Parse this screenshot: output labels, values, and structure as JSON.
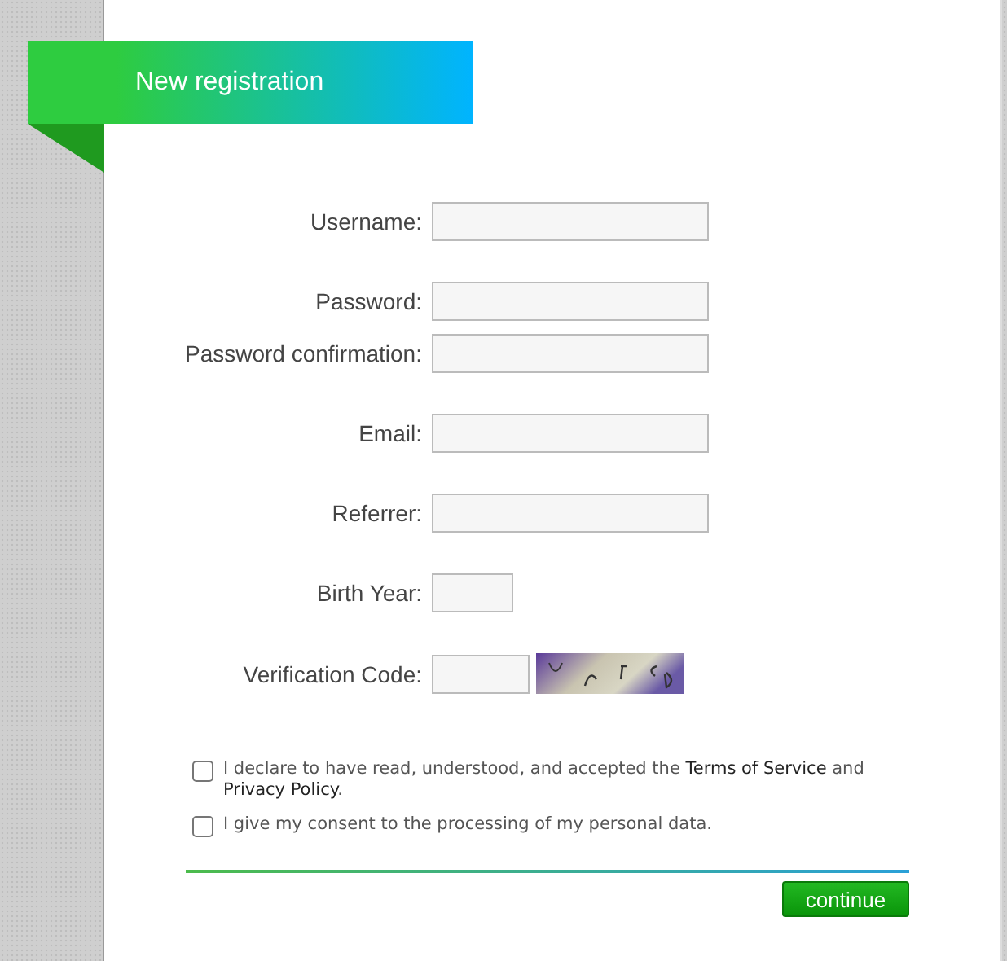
{
  "header": {
    "title": "New registration"
  },
  "field_groups": [
    [
      {
        "label": "Username:",
        "kind": "text"
      }
    ],
    [
      {
        "label": "Password:",
        "kind": "text"
      },
      {
        "label": "Password confirmation:",
        "kind": "text"
      }
    ],
    [
      {
        "label": "Email:",
        "kind": "text"
      }
    ],
    [
      {
        "label": "Referrer:",
        "kind": "text"
      }
    ],
    [
      {
        "label": "Birth Year:",
        "kind": "year"
      }
    ],
    [
      {
        "label": "Verification Code:",
        "kind": "captcha"
      }
    ]
  ],
  "agreements": [
    {
      "checked": false,
      "parts": [
        {
          "kind": "text",
          "text": "I declare to have read, understood, and accepted the "
        },
        {
          "kind": "link",
          "text": "Terms of Service"
        },
        {
          "kind": "text",
          "text": " and "
        },
        {
          "kind": "link",
          "text": "Privacy Policy"
        },
        {
          "kind": "text",
          "text": "."
        }
      ]
    },
    {
      "checked": false,
      "parts": [
        {
          "kind": "text",
          "text": "I give my consent to the processing of my personal data."
        }
      ]
    }
  ],
  "submit": {
    "label": "continue"
  }
}
